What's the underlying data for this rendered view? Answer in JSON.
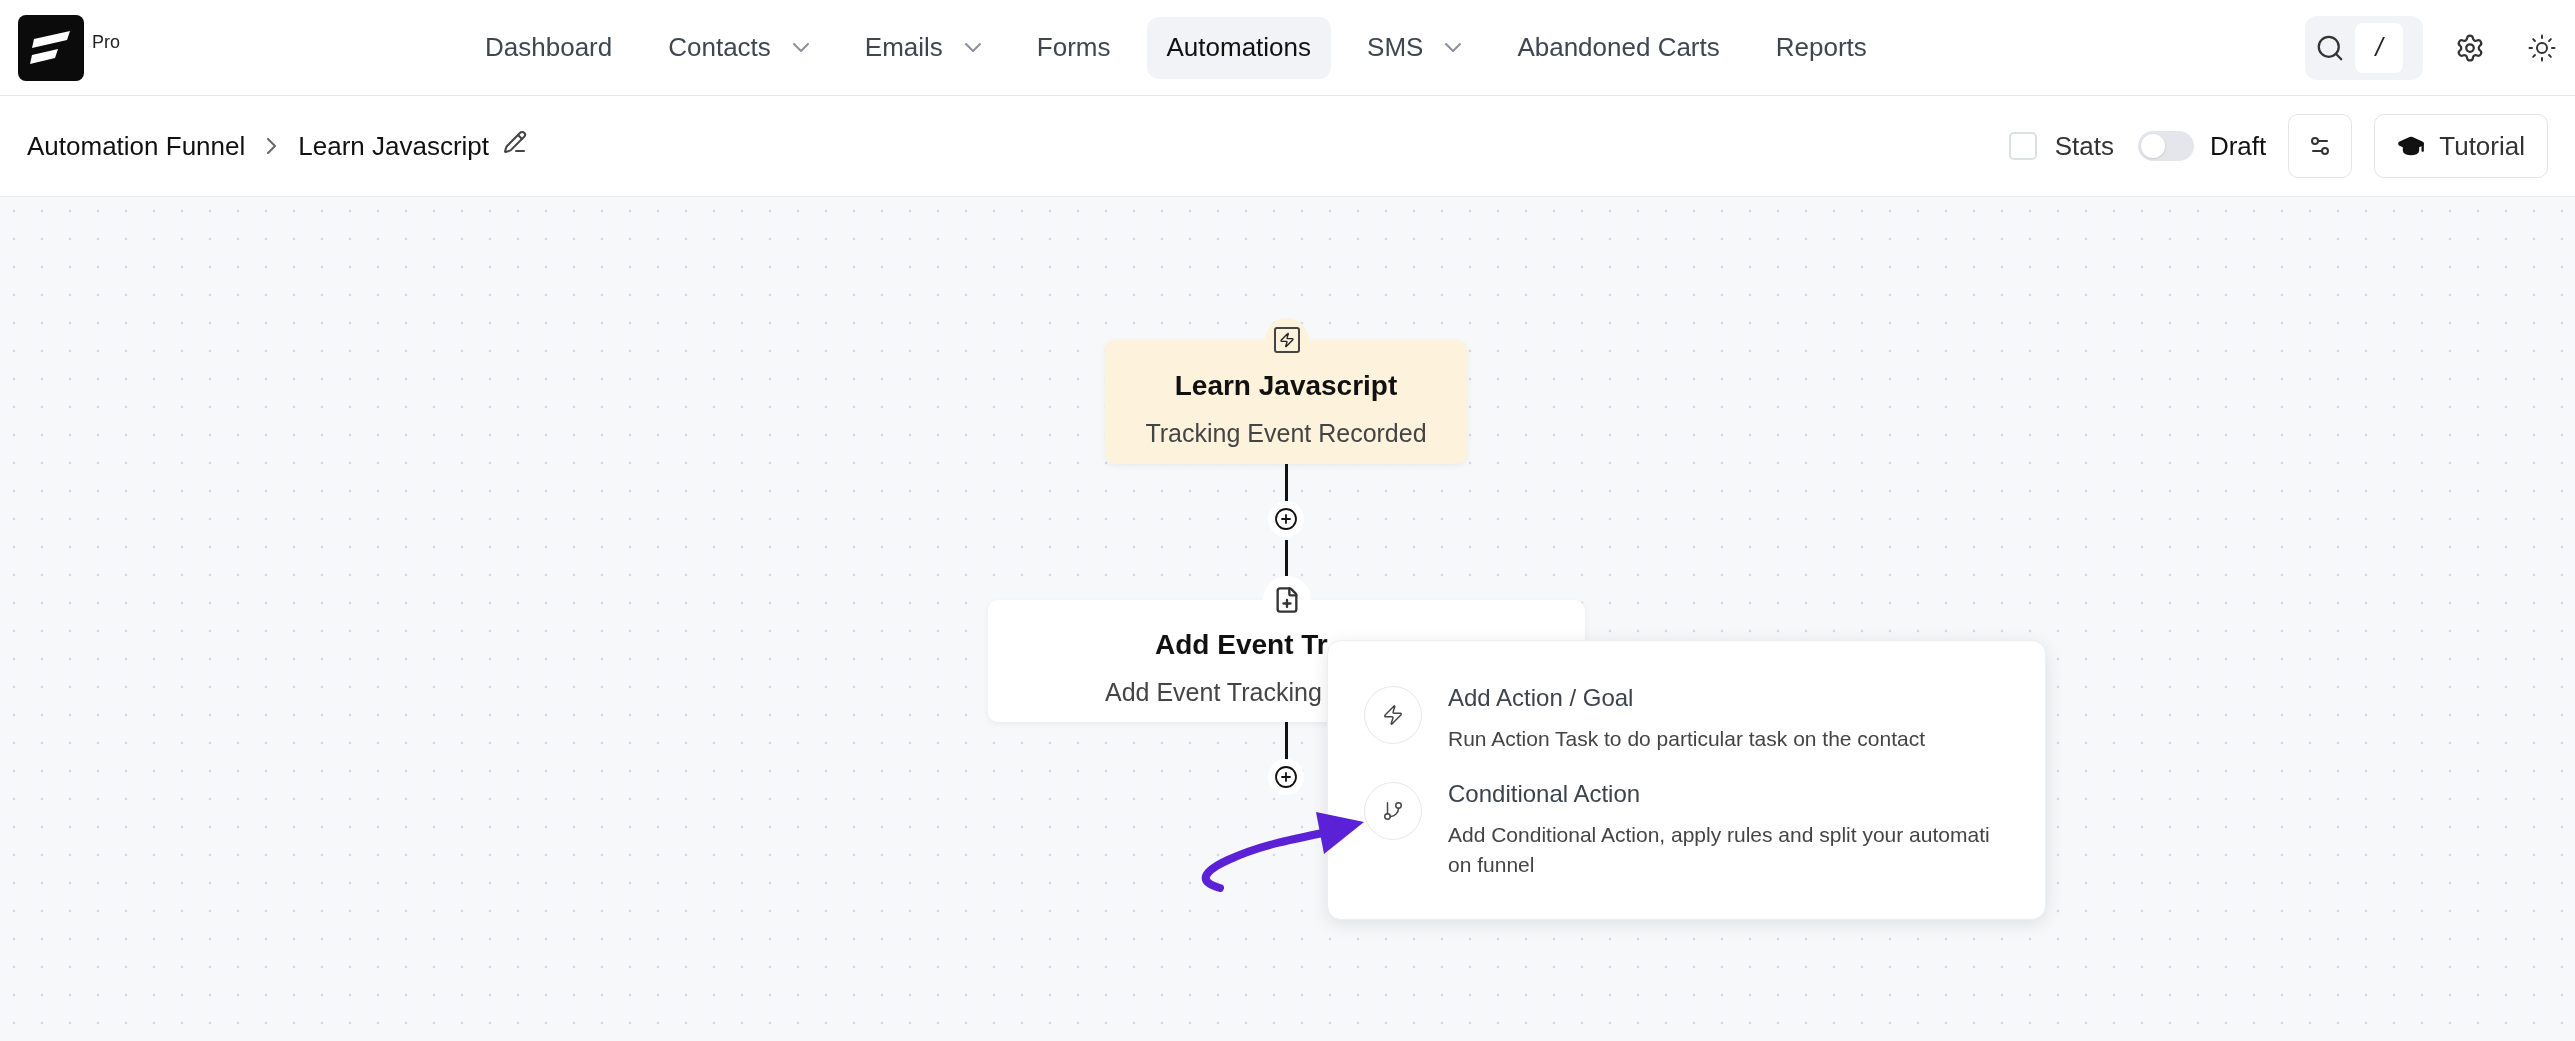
{
  "app": {
    "badge": "Pro"
  },
  "nav": [
    {
      "label": "Dashboard",
      "selected": false,
      "dropdown": false
    },
    {
      "label": "Contacts",
      "selected": false,
      "dropdown": true
    },
    {
      "label": "Emails",
      "selected": false,
      "dropdown": true
    },
    {
      "label": "Forms",
      "selected": false,
      "dropdown": false
    },
    {
      "label": "Automations",
      "selected": true,
      "dropdown": false
    },
    {
      "label": "SMS",
      "selected": false,
      "dropdown": true
    },
    {
      "label": "Abandoned Carts",
      "selected": false,
      "dropdown": false
    },
    {
      "label": "Reports",
      "selected": false,
      "dropdown": false
    }
  ],
  "search": {
    "shortcut": "/"
  },
  "breadcrumb": {
    "parent": "Automation Funnel",
    "current": "Learn Javascript"
  },
  "toolbar": {
    "stats": {
      "label": "Stats",
      "checked": false
    },
    "draft": {
      "label": "Draft",
      "on": false
    },
    "tutorial": "Tutorial"
  },
  "funnel": [
    {
      "kind": "trigger",
      "title": "Learn Javascript",
      "subtitle": "Tracking Event Recorded"
    },
    {
      "kind": "action",
      "title": "Add Event Tr",
      "subtitle": "Add Event Tracking"
    }
  ],
  "menu": {
    "items": [
      {
        "kind": "action",
        "title": "Add Action / Goal",
        "description": "Run Action Task to do particular task on the contact"
      },
      {
        "kind": "conditional",
        "title": "Conditional Action",
        "description": "Add Conditional Action, apply rules and split your automation funnel"
      }
    ]
  }
}
